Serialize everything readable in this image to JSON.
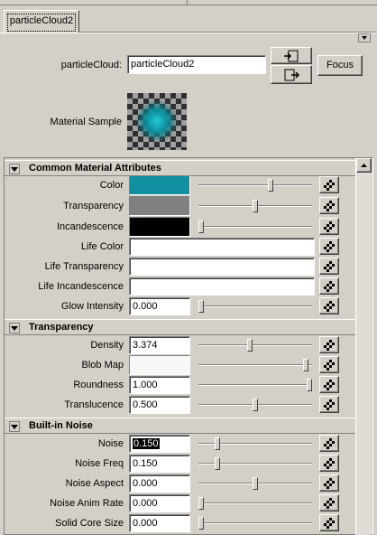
{
  "tab": {
    "label": "particleCloud2"
  },
  "node": {
    "field_label": "particleCloud:",
    "field_value": "particleCloud2",
    "focus_label": "Focus",
    "material_sample_label": "Material Sample"
  },
  "sections": {
    "common": {
      "title": "Common Material Attributes",
      "color_label": "Color",
      "transparency_label": "Transparency",
      "incandescence_label": "Incandescence",
      "life_color_label": "Life Color",
      "life_transparency_label": "Life Transparency",
      "life_incandescence_label": "Life Incandescence",
      "glow_label": "Glow Intensity",
      "glow_value": "0.000",
      "color_hex": "#1090a0",
      "transparency_hex": "#808080",
      "incandescence_hex": "#000000",
      "color_slider": 0.64,
      "transparency_slider": 0.5,
      "incandescence_slider": 0.0,
      "glow_slider": 0.0
    },
    "transparency": {
      "title": "Transparency",
      "density_label": "Density",
      "density_value": "3.374",
      "density_slider": 0.45,
      "blob_label": "Blob Map",
      "blob_hex": "#f8f8f8",
      "blob_slider": 0.97,
      "roundness_label": "Roundness",
      "roundness_value": "1.000",
      "roundness_slider": 1.0,
      "translucence_label": "Translucence",
      "translucence_value": "0.500",
      "translucence_slider": 0.5
    },
    "noise": {
      "title": "Built-in Noise",
      "noise_label": "Noise",
      "noise_value": "0.150",
      "noise_slider": 0.15,
      "freq_label": "Noise Freq",
      "freq_value": "0.150",
      "freq_slider": 0.15,
      "aspect_label": "Noise Aspect",
      "aspect_value": "0.000",
      "aspect_slider": 0.5,
      "anim_label": "Noise Anim Rate",
      "anim_value": "0.000",
      "anim_slider": 0.0,
      "solid_label": "Solid Core Size",
      "solid_value": "0.000",
      "solid_slider": 0.0
    }
  },
  "icons": {
    "map": "checker-map-icon",
    "load": "load-attributes-icon",
    "copy": "copy-tab-icon",
    "collapse": "triangle-down-icon"
  }
}
